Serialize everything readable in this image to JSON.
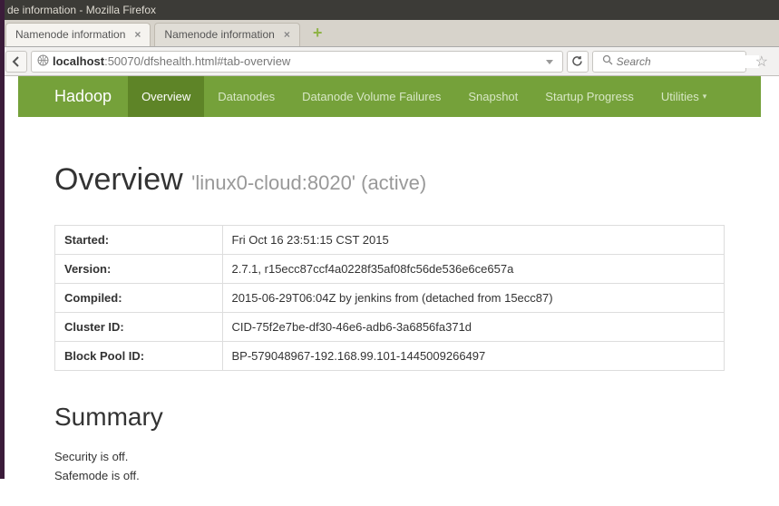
{
  "window": {
    "title": "de information - Mozilla Firefox"
  },
  "tabs": [
    {
      "label": "Namenode information"
    },
    {
      "label": "Namenode information"
    }
  ],
  "url": {
    "host": "localhost",
    "rest": ":50070/dfshealth.html#tab-overview"
  },
  "search": {
    "placeholder": "Search"
  },
  "hadoop_nav": {
    "brand": "Hadoop",
    "items": [
      "Overview",
      "Datanodes",
      "Datanode Volume Failures",
      "Snapshot",
      "Startup Progress",
      "Utilities"
    ]
  },
  "overview": {
    "heading": "Overview",
    "sub": "'linux0-cloud:8020' (active)",
    "rows": [
      {
        "k": "Started:",
        "v": "Fri Oct 16 23:51:15 CST 2015"
      },
      {
        "k": "Version:",
        "v": "2.7.1, r15ecc87ccf4a0228f35af08fc56de536e6ce657a"
      },
      {
        "k": "Compiled:",
        "v": "2015-06-29T06:04Z by jenkins from (detached from 15ecc87)"
      },
      {
        "k": "Cluster ID:",
        "v": "CID-75f2e7be-df30-46e6-adb6-3a6856fa371d"
      },
      {
        "k": "Block Pool ID:",
        "v": "BP-579048967-192.168.99.101-1445009266497"
      }
    ]
  },
  "summary": {
    "heading": "Summary",
    "lines": [
      "Security is off.",
      "Safemode is off."
    ]
  }
}
